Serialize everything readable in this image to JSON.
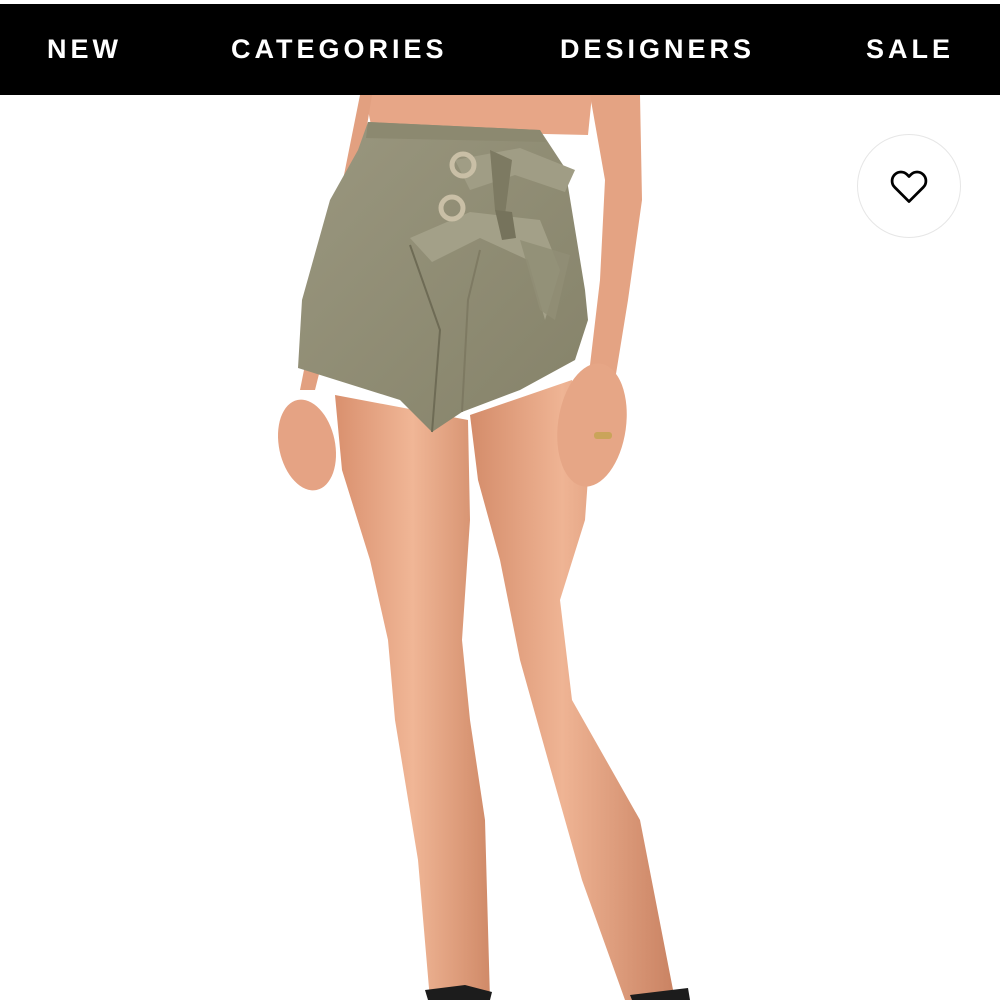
{
  "nav": {
    "items": [
      {
        "label": "NEW"
      },
      {
        "label": "CATEGORIES"
      },
      {
        "label": "DESIGNERS"
      },
      {
        "label": "SALE"
      }
    ]
  },
  "product_image": {
    "icon": "heart-icon"
  },
  "colors": {
    "nav_background": "#000000",
    "nav_text": "#ffffff",
    "product_fabric": "#8f8c74",
    "skin": "#e8a888"
  }
}
